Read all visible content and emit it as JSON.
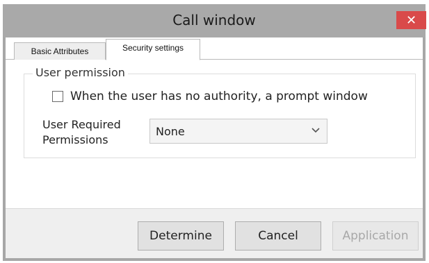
{
  "window": {
    "title": "Call window",
    "close_glyph": "✕",
    "close_color": "#d94a4a"
  },
  "tabs": [
    {
      "label": "Basic Attributes",
      "active": false
    },
    {
      "label": "Security settings",
      "active": true
    }
  ],
  "group": {
    "legend": "User permission",
    "checkbox_label": "When the user has no authority, a prompt window",
    "checkbox_checked": false,
    "permission_label": "User Required Permissions",
    "select_value": "None",
    "select_icon": "chevron-down-icon"
  },
  "buttons": {
    "determine": "Determine",
    "cancel": "Cancel",
    "apply": "Application"
  }
}
